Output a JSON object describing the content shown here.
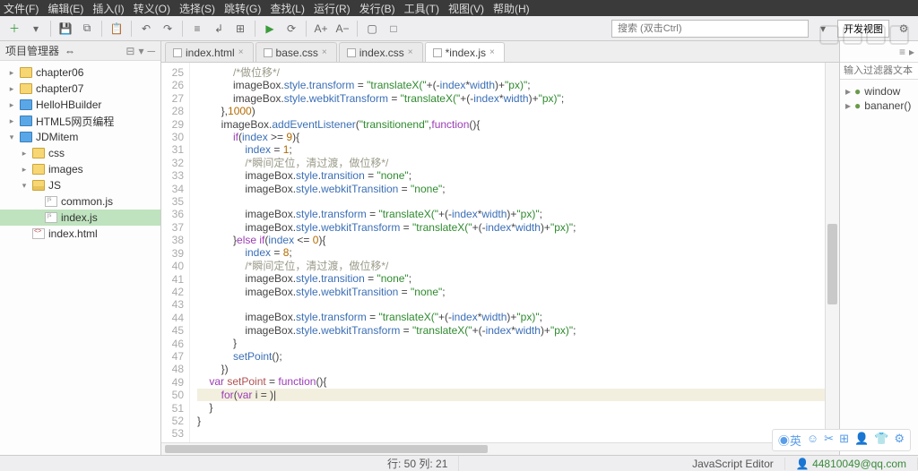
{
  "menu": [
    "文件(F)",
    "编辑(E)",
    "插入(I)",
    "转义(O)",
    "选择(S)",
    "跳转(G)",
    "查找(L)",
    "运行(R)",
    "发行(B)",
    "工具(T)",
    "视图(V)",
    "帮助(H)"
  ],
  "toolbar": {
    "search_ph": "搜索 (双击Ctrl)",
    "devview": "开发视图"
  },
  "project_panel": {
    "title": "项目管理器"
  },
  "tree": [
    {
      "d": 1,
      "tw": "▸",
      "ico": "fold",
      "label": "chapter06",
      "sel": false
    },
    {
      "d": 1,
      "tw": "▸",
      "ico": "fold",
      "label": "chapter07",
      "sel": false
    },
    {
      "d": 1,
      "tw": "▸",
      "ico": "proj",
      "label": "HelloHBuilder",
      "sel": false
    },
    {
      "d": 1,
      "tw": "▸",
      "ico": "proj",
      "label": "HTML5网页编程",
      "sel": false
    },
    {
      "d": 1,
      "tw": "▾",
      "ico": "proj",
      "label": "JDMitem",
      "sel": false
    },
    {
      "d": 2,
      "tw": "▸",
      "ico": "fold",
      "label": "css",
      "sel": false
    },
    {
      "d": 2,
      "tw": "▸",
      "ico": "fold",
      "label": "images",
      "sel": false
    },
    {
      "d": 2,
      "tw": "▾",
      "ico": "fold-o",
      "label": "JS",
      "sel": false
    },
    {
      "d": 3,
      "tw": "",
      "ico": "js",
      "label": "common.js",
      "sel": false
    },
    {
      "d": 3,
      "tw": "",
      "ico": "js",
      "label": "index.js",
      "sel": true
    },
    {
      "d": 2,
      "tw": "",
      "ico": "html",
      "label": "index.html",
      "sel": false
    }
  ],
  "tabs": [
    {
      "label": "index.html",
      "dirty": false,
      "act": false
    },
    {
      "label": "base.css",
      "dirty": false,
      "act": false
    },
    {
      "label": "index.css",
      "dirty": false,
      "act": false
    },
    {
      "label": "*index.js",
      "dirty": true,
      "act": true
    }
  ],
  "outline": {
    "filter_ph": "输入过滤器文本",
    "items": [
      "window",
      "bananer()"
    ]
  },
  "status": {
    "pos": "行: 50 列: 21",
    "mode": "JavaScript Editor",
    "email": "44810049@qq.com"
  },
  "code": {
    "start": 25,
    "lines": [
      [
        {
          "c": "cm",
          "t": "            /*做位移*/"
        }
      ],
      [
        {
          "c": "o",
          "t": "            imageBox."
        },
        {
          "c": "p",
          "t": "style"
        },
        {
          "c": "o",
          "t": "."
        },
        {
          "c": "p",
          "t": "transform"
        },
        {
          "c": "o",
          "t": " = "
        },
        {
          "c": "str",
          "t": "\"translateX(\""
        },
        {
          "c": "o",
          "t": "+(-"
        },
        {
          "c": "p",
          "t": "index"
        },
        {
          "c": "o",
          "t": "*"
        },
        {
          "c": "p",
          "t": "width"
        },
        {
          "c": "o",
          "t": ")+"
        },
        {
          "c": "str",
          "t": "\"px)\""
        },
        {
          "c": "o",
          "t": ";"
        }
      ],
      [
        {
          "c": "o",
          "t": "            imageBox."
        },
        {
          "c": "p",
          "t": "style"
        },
        {
          "c": "o",
          "t": "."
        },
        {
          "c": "p",
          "t": "webkitTransform"
        },
        {
          "c": "o",
          "t": " = "
        },
        {
          "c": "str",
          "t": "\"translateX(\""
        },
        {
          "c": "o",
          "t": "+(-"
        },
        {
          "c": "p",
          "t": "index"
        },
        {
          "c": "o",
          "t": "*"
        },
        {
          "c": "p",
          "t": "width"
        },
        {
          "c": "o",
          "t": ")+"
        },
        {
          "c": "str",
          "t": "\"px)\""
        },
        {
          "c": "o",
          "t": ";"
        }
      ],
      [
        {
          "c": "o",
          "t": "        },"
        },
        {
          "c": "num",
          "t": "1000"
        },
        {
          "c": "o",
          "t": ")"
        }
      ],
      [
        {
          "c": "o",
          "t": "        imageBox."
        },
        {
          "c": "p",
          "t": "addEventListener"
        },
        {
          "c": "o",
          "t": "("
        },
        {
          "c": "str",
          "t": "\"transitionend\""
        },
        {
          "c": "o",
          "t": ","
        },
        {
          "c": "kw",
          "t": "function"
        },
        {
          "c": "o",
          "t": "(){"
        }
      ],
      [
        {
          "c": "o",
          "t": "            "
        },
        {
          "c": "kw",
          "t": "if"
        },
        {
          "c": "o",
          "t": "("
        },
        {
          "c": "p",
          "t": "index"
        },
        {
          "c": "o",
          "t": " >= "
        },
        {
          "c": "num",
          "t": "9"
        },
        {
          "c": "o",
          "t": "){"
        }
      ],
      [
        {
          "c": "o",
          "t": "                "
        },
        {
          "c": "p",
          "t": "index"
        },
        {
          "c": "o",
          "t": " = "
        },
        {
          "c": "num",
          "t": "1"
        },
        {
          "c": "o",
          "t": ";"
        }
      ],
      [
        {
          "c": "cm",
          "t": "                /*瞬间定位，清过渡，做位移*/"
        }
      ],
      [
        {
          "c": "o",
          "t": "                imageBox."
        },
        {
          "c": "p",
          "t": "style"
        },
        {
          "c": "o",
          "t": "."
        },
        {
          "c": "p",
          "t": "transition"
        },
        {
          "c": "o",
          "t": " = "
        },
        {
          "c": "str",
          "t": "\"none\""
        },
        {
          "c": "o",
          "t": ";"
        }
      ],
      [
        {
          "c": "o",
          "t": "                imageBox."
        },
        {
          "c": "p",
          "t": "style"
        },
        {
          "c": "o",
          "t": "."
        },
        {
          "c": "p",
          "t": "webkitTransition"
        },
        {
          "c": "o",
          "t": " = "
        },
        {
          "c": "str",
          "t": "\"none\""
        },
        {
          "c": "o",
          "t": ";"
        }
      ],
      [
        {
          "c": "o",
          "t": ""
        }
      ],
      [
        {
          "c": "o",
          "t": "                imageBox."
        },
        {
          "c": "p",
          "t": "style"
        },
        {
          "c": "o",
          "t": "."
        },
        {
          "c": "p",
          "t": "transform"
        },
        {
          "c": "o",
          "t": " = "
        },
        {
          "c": "str",
          "t": "\"translateX(\""
        },
        {
          "c": "o",
          "t": "+(-"
        },
        {
          "c": "p",
          "t": "index"
        },
        {
          "c": "o",
          "t": "*"
        },
        {
          "c": "p",
          "t": "width"
        },
        {
          "c": "o",
          "t": ")+"
        },
        {
          "c": "str",
          "t": "\"px)\""
        },
        {
          "c": "o",
          "t": ";"
        }
      ],
      [
        {
          "c": "o",
          "t": "                imageBox."
        },
        {
          "c": "p",
          "t": "style"
        },
        {
          "c": "o",
          "t": "."
        },
        {
          "c": "p",
          "t": "webkitTransform"
        },
        {
          "c": "o",
          "t": " = "
        },
        {
          "c": "str",
          "t": "\"translateX(\""
        },
        {
          "c": "o",
          "t": "+(-"
        },
        {
          "c": "p",
          "t": "index"
        },
        {
          "c": "o",
          "t": "*"
        },
        {
          "c": "p",
          "t": "width"
        },
        {
          "c": "o",
          "t": ")+"
        },
        {
          "c": "str",
          "t": "\"px)\""
        },
        {
          "c": "o",
          "t": ";"
        }
      ],
      [
        {
          "c": "o",
          "t": "            }"
        },
        {
          "c": "kw",
          "t": "else if"
        },
        {
          "c": "o",
          "t": "("
        },
        {
          "c": "p",
          "t": "index"
        },
        {
          "c": "o",
          "t": " <= "
        },
        {
          "c": "num",
          "t": "0"
        },
        {
          "c": "o",
          "t": "){"
        }
      ],
      [
        {
          "c": "o",
          "t": "                "
        },
        {
          "c": "p",
          "t": "index"
        },
        {
          "c": "o",
          "t": " = "
        },
        {
          "c": "num",
          "t": "8"
        },
        {
          "c": "o",
          "t": ";"
        }
      ],
      [
        {
          "c": "cm",
          "t": "                /*瞬间定位，清过渡，做位移*/"
        }
      ],
      [
        {
          "c": "o",
          "t": "                imageBox."
        },
        {
          "c": "p",
          "t": "style"
        },
        {
          "c": "o",
          "t": "."
        },
        {
          "c": "p",
          "t": "transition"
        },
        {
          "c": "o",
          "t": " = "
        },
        {
          "c": "str",
          "t": "\"none\""
        },
        {
          "c": "o",
          "t": ";"
        }
      ],
      [
        {
          "c": "o",
          "t": "                imageBox."
        },
        {
          "c": "p",
          "t": "style"
        },
        {
          "c": "o",
          "t": "."
        },
        {
          "c": "p",
          "t": "webkitTransition"
        },
        {
          "c": "o",
          "t": " = "
        },
        {
          "c": "str",
          "t": "\"none\""
        },
        {
          "c": "o",
          "t": ";"
        }
      ],
      [
        {
          "c": "o",
          "t": ""
        }
      ],
      [
        {
          "c": "o",
          "t": "                imageBox."
        },
        {
          "c": "p",
          "t": "style"
        },
        {
          "c": "o",
          "t": "."
        },
        {
          "c": "p",
          "t": "transform"
        },
        {
          "c": "o",
          "t": " = "
        },
        {
          "c": "str",
          "t": "\"translateX(\""
        },
        {
          "c": "o",
          "t": "+(-"
        },
        {
          "c": "p",
          "t": "index"
        },
        {
          "c": "o",
          "t": "*"
        },
        {
          "c": "p",
          "t": "width"
        },
        {
          "c": "o",
          "t": ")+"
        },
        {
          "c": "str",
          "t": "\"px)\""
        },
        {
          "c": "o",
          "t": ";"
        }
      ],
      [
        {
          "c": "o",
          "t": "                imageBox."
        },
        {
          "c": "p",
          "t": "style"
        },
        {
          "c": "o",
          "t": "."
        },
        {
          "c": "p",
          "t": "webkitTransform"
        },
        {
          "c": "o",
          "t": " = "
        },
        {
          "c": "str",
          "t": "\"translateX(\""
        },
        {
          "c": "o",
          "t": "+(-"
        },
        {
          "c": "p",
          "t": "index"
        },
        {
          "c": "o",
          "t": "*"
        },
        {
          "c": "p",
          "t": "width"
        },
        {
          "c": "o",
          "t": ")+"
        },
        {
          "c": "str",
          "t": "\"px)\""
        },
        {
          "c": "o",
          "t": ";"
        }
      ],
      [
        {
          "c": "o",
          "t": "            }"
        }
      ],
      [
        {
          "c": "o",
          "t": "            "
        },
        {
          "c": "p",
          "t": "setPoint"
        },
        {
          "c": "o",
          "t": "();"
        }
      ],
      [
        {
          "c": "o",
          "t": "        })"
        }
      ],
      [
        {
          "c": "o",
          "t": "    "
        },
        {
          "c": "kw",
          "t": "var"
        },
        {
          "c": "o",
          "t": " "
        },
        {
          "c": "fn",
          "t": "setPoint"
        },
        {
          "c": "o",
          "t": " = "
        },
        {
          "c": "kw",
          "t": "function"
        },
        {
          "c": "o",
          "t": "(){"
        }
      ],
      [
        {
          "c": "o",
          "t": "        "
        },
        {
          "c": "kw",
          "t": "for"
        },
        {
          "c": "o",
          "t": "("
        },
        {
          "c": "kw",
          "t": "var"
        },
        {
          "c": "o",
          "t": " i = )|"
        }
      ],
      [
        {
          "c": "o",
          "t": "    }"
        }
      ],
      [
        {
          "c": "o",
          "t": "}"
        }
      ],
      [
        {
          "c": "o",
          "t": ""
        }
      ]
    ],
    "current_line": 50
  }
}
